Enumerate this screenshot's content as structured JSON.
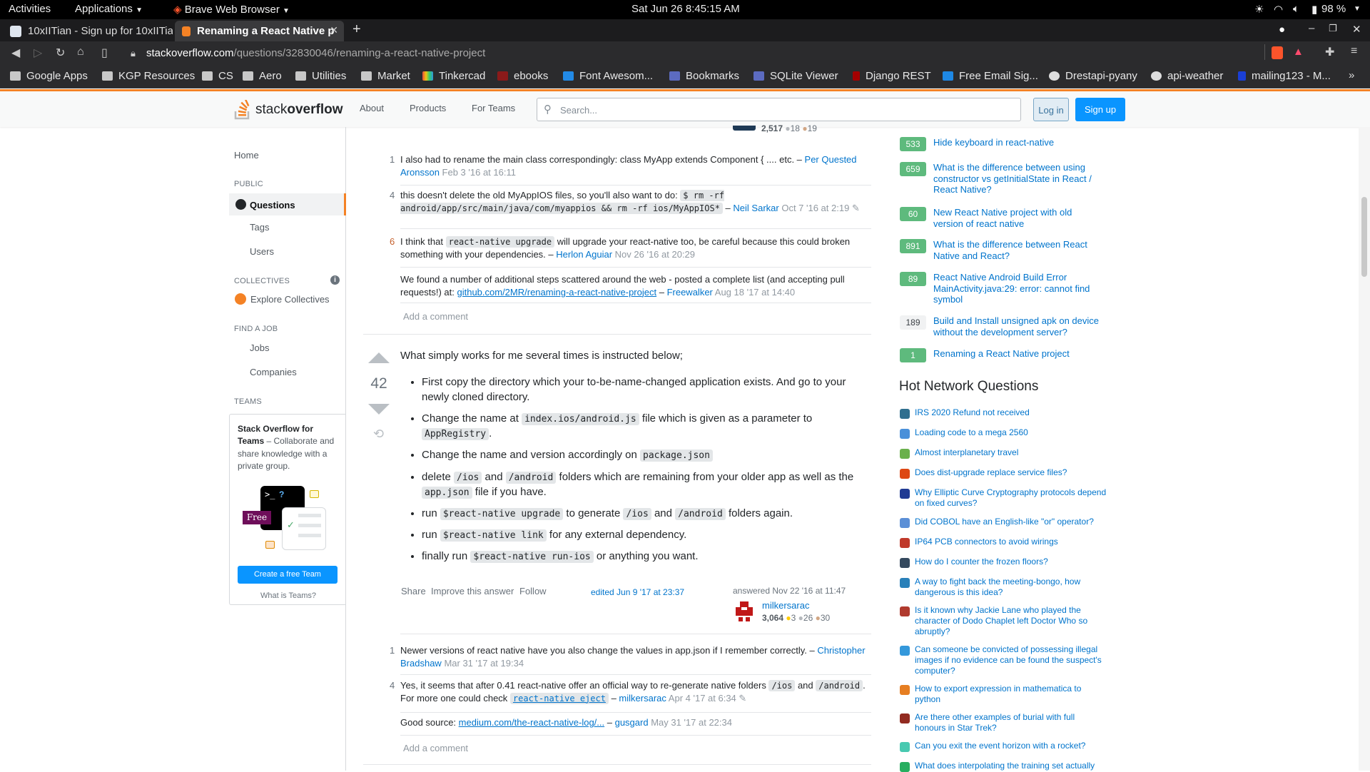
{
  "gnome": {
    "activities": "Activities",
    "applications": "Applications",
    "browser": "Brave Web Browser",
    "datetime": "Sat Jun 26   8:45:15 AM",
    "battery": "98 %"
  },
  "tabs": [
    {
      "title": "10xIITian - Sign up for 10xIITia"
    },
    {
      "title": "Renaming a React Native p"
    }
  ],
  "address": {
    "host": "stackoverflow.com",
    "path": "/questions/32830046/renaming-a-react-native-project"
  },
  "bookmarks": [
    "Google Apps",
    "KGP Resources",
    "CS",
    "Aero",
    "Utilities",
    "Market",
    "Tinkercad",
    "ebooks",
    "Font Awesom...",
    "Bookmarks",
    "SQLite Viewer",
    "Django REST",
    "Free Email Sig...",
    "Drestapi-pyany",
    "api-weather",
    "mailing123 - M..."
  ],
  "so": {
    "logo_stack": "stack",
    "logo_overflow": "overflow",
    "nav": [
      "About",
      "Products",
      "For Teams"
    ],
    "search_placeholder": "Search...",
    "login": "Log in",
    "signup": "Sign up"
  },
  "leftnav": {
    "home": "Home",
    "public": "PUBLIC",
    "questions": "Questions",
    "tags": "Tags",
    "users": "Users",
    "collectives": "COLLECTIVES",
    "explore": "Explore Collectives",
    "findjob": "FIND A JOB",
    "jobs": "Jobs",
    "companies": "Companies",
    "teams": "TEAMS",
    "teams_title": "Stack Overflow for Teams",
    "teams_desc": " – Collaborate and share knowledge with a private group.",
    "free": "Free",
    "create_team": "Create a free Team",
    "what_teams": "What is Teams?"
  },
  "top_user": {
    "rep": "2,517",
    "silver": "18",
    "bronze": "19"
  },
  "comments1": [
    {
      "score": "1",
      "text": "I also had to rename the main class correspondingly: class MyApp extends Component { .... etc. –",
      "user": "Per Quested Aronsson",
      "date": "Feb 3 '16 at 16:11"
    },
    {
      "score": "4",
      "text_a": "this doesn't delete the old MyAppIOS files, so you'll also want to do: ",
      "code": "$ rm -rf android/app/src/main/java/com/myappios && rm -rf ios/MyAppIOS*",
      "user": "Neil Sarkar",
      "date": "Oct 7 '16 at 2:19"
    },
    {
      "score": "6",
      "text_a": "I think that ",
      "code": "react-native upgrade",
      "text_b": " will upgrade your react-native too, be careful because this could broken something with your dependencies. –",
      "user": "Herlon Aguiar",
      "date": "Nov 26 '16 at 20:29"
    },
    {
      "score": "",
      "text_a": "We found a number of additional steps scattered around the web - posted a complete list (and accepting pull requests!) at: ",
      "link": "github.com/2MR/renaming-a-react-native-project",
      "user": "Freewalker",
      "date": "Aug 18 '17 at 14:40"
    }
  ],
  "add_comment": "Add a comment",
  "answer": {
    "votes": "42",
    "intro": "What simply works for me several times is instructed below;",
    "items": [
      {
        "a": "First copy the directory which your to-be-name-changed application exists. And go to your newly cloned directory."
      },
      {
        "a": "Change the name at ",
        "c1": "index.ios/android.js",
        "b": " file which is given as a parameter to ",
        "c2": "AppRegistry",
        "d": "."
      },
      {
        "a": "Change the name and version accordingly on ",
        "c1": "package.json"
      },
      {
        "a": "delete ",
        "c1": "/ios",
        "b": " and ",
        "c2": "/android",
        "d": " folders which are remaining from your older app as well as the ",
        "c3": "app.json",
        "e": " file if you have."
      },
      {
        "a": "run ",
        "c1": "$react-native upgrade",
        "b": " to generate ",
        "c2": "/ios",
        "d": " and ",
        "c3": "/android",
        "e": " folders again."
      },
      {
        "a": "run ",
        "c1": "$react-native link",
        "b": " for any external dependency."
      },
      {
        "a": "finally run ",
        "c1": "$react-native run-ios",
        "b": " or anything you want."
      }
    ],
    "share": "Share",
    "improve": "Improve this answer",
    "follow": "Follow",
    "edited": "edited Jun 9 '17 at 23:37",
    "answered": "answered Nov 22 '16 at 11:47",
    "user": "milkersarac",
    "rep": "3,064",
    "gold": "3",
    "silver": "26",
    "bronze": "30"
  },
  "comments2": [
    {
      "score": "1",
      "text": "Newer versions of react native have you also change the values in app.json if I remember correctly. –",
      "user": "Christopher Bradshaw",
      "date": "Mar 31 '17 at 19:34"
    },
    {
      "score": "4",
      "text_a": "Yes, it seems that after 0.41 react-native offer an official way to re-generate native folders ",
      "c1": "/ios",
      "text_b": " and ",
      "c2": "/android",
      "text_c": ". For more one could check ",
      "c3": "react-native eject",
      "user": "milkersarac",
      "date": "Apr 4 '17 at 6:34"
    },
    {
      "score": "",
      "text_a": "Good source: ",
      "link": "medium.com/the-react-native-log/...",
      "user": "gusgard",
      "date": "May 31 '17 at 22:34"
    }
  ],
  "related": [
    {
      "count": "533",
      "title": "Hide keyboard in react-native",
      "accepted": true
    },
    {
      "count": "659",
      "title": "What is the difference between using constructor vs getInitialState in React / React Native?",
      "accepted": true
    },
    {
      "count": "60",
      "title": "New React Native project with old version of react native",
      "accepted": true
    },
    {
      "count": "891",
      "title": "What is the difference between React Native and React?",
      "accepted": true
    },
    {
      "count": "89",
      "title": "React Native Android Build Error MainActivity.java:29: error: cannot find symbol",
      "accepted": true
    },
    {
      "count": "189",
      "title": "Build and Install unsigned apk on device without the development server?",
      "accepted": false
    },
    {
      "count": "1",
      "title": "Renaming a React Native project",
      "accepted": true
    }
  ],
  "hnq_title": "Hot Network Questions",
  "hnq": [
    {
      "title": "IRS 2020 Refund not received",
      "color": "#2f6f8f"
    },
    {
      "title": "Loading code to a mega 2560",
      "color": "#4a90d9"
    },
    {
      "title": "Almost interplanetary travel",
      "color": "#6ab04c"
    },
    {
      "title": "Does dist-upgrade replace service files?",
      "color": "#dd4814"
    },
    {
      "title": "Why Elliptic Curve Cryptography protocols depend on fixed curves?",
      "color": "#1f3a93"
    },
    {
      "title": "Did COBOL have an English-like \"or\" operator?",
      "color": "#5b8fd6"
    },
    {
      "title": "IP64 PCB connectors to avoid wirings",
      "color": "#c0392b"
    },
    {
      "title": "How do I counter the frozen floors?",
      "color": "#34495e"
    },
    {
      "title": "A way to fight back the meeting-bongo, how dangerous is this idea?",
      "color": "#2980b9"
    },
    {
      "title": "Is it known why Jackie Lane who played the character of Dodo Chaplet left Doctor Who so abruptly?",
      "color": "#b03a2e"
    },
    {
      "title": "Can someone be convicted of possessing illegal images if no evidence can be found the suspect's computer?",
      "color": "#3498db"
    },
    {
      "title": "How to export expression in mathematica to python",
      "color": "#e67e22"
    },
    {
      "title": "Are there other examples of burial with full honours in Star Trek?",
      "color": "#922b21"
    },
    {
      "title": "Can you exit the event horizon with a rocket?",
      "color": "#48c9b0"
    },
    {
      "title": "What does interpolating the training set actually",
      "color": "#27ae60"
    }
  ]
}
